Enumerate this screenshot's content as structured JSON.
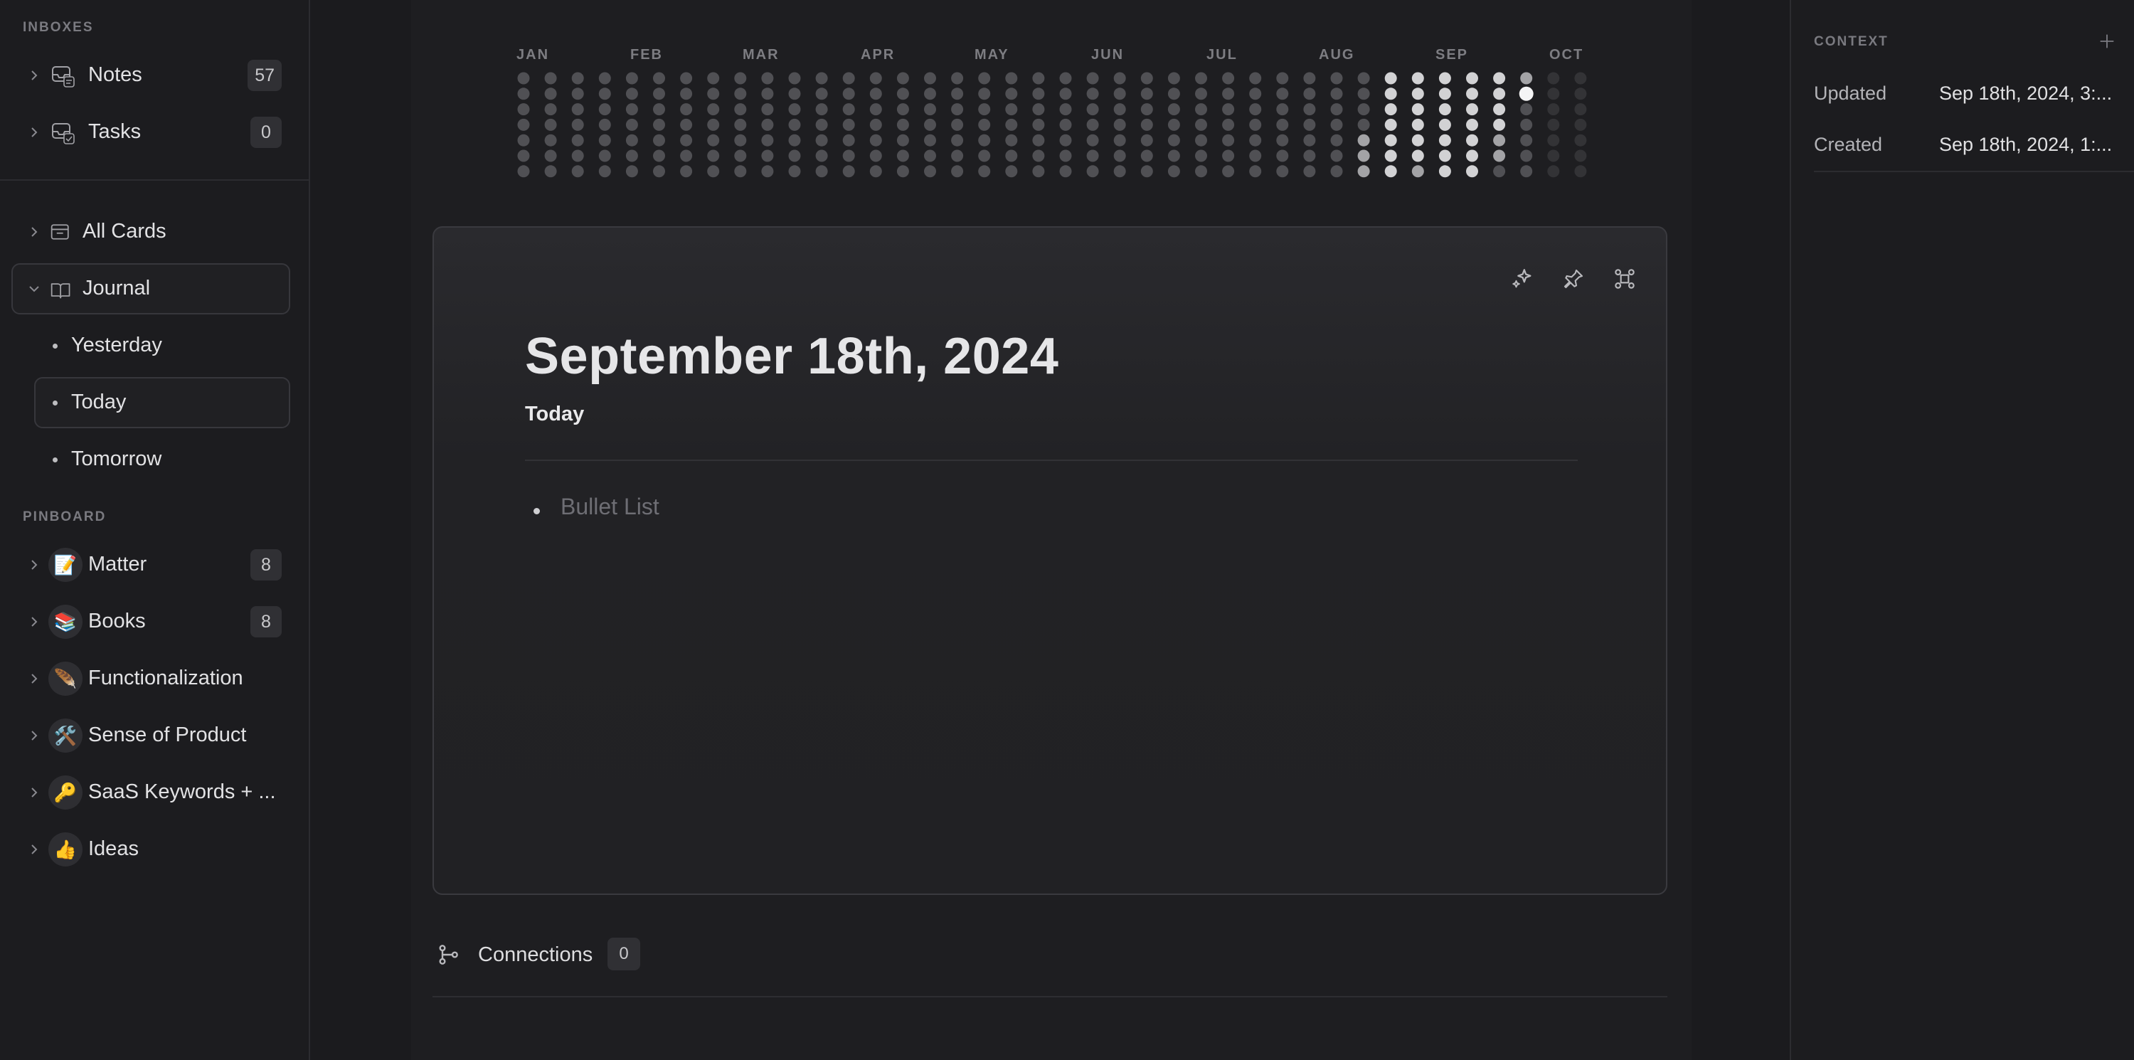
{
  "sidebar": {
    "inboxes_label": "INBOXES",
    "inboxes": [
      {
        "label": "Notes",
        "count": "57"
      },
      {
        "label": "Tasks",
        "count": "0"
      }
    ],
    "all_cards": {
      "label": "All Cards"
    },
    "journal": {
      "label": "Journal",
      "children": [
        {
          "label": "Yesterday"
        },
        {
          "label": "Today"
        },
        {
          "label": "Tomorrow"
        }
      ]
    },
    "pinboard_label": "PINBOARD",
    "pinboard": [
      {
        "label": "Matter",
        "emoji": "📝",
        "count": "8"
      },
      {
        "label": "Books",
        "emoji": "📚",
        "count": "8"
      },
      {
        "label": "Functionalization",
        "emoji": "🪶",
        "count": ""
      },
      {
        "label": "Sense of Product",
        "emoji": "🛠️",
        "count": ""
      },
      {
        "label": "SaaS Keywords + ...",
        "emoji": "🔑",
        "count": ""
      },
      {
        "label": "Ideas",
        "emoji": "👍",
        "count": ""
      }
    ]
  },
  "heatmap": {
    "months": [
      "JAN",
      "FEB",
      "MAR",
      "APR",
      "MAY",
      "JUN",
      "JUL",
      "AUG",
      "SEP",
      "OCT"
    ],
    "weeks": 40,
    "days": 7,
    "levels": {
      "31": [
        0,
        0,
        0,
        0,
        2,
        2,
        2
      ],
      "32": [
        3,
        3,
        3,
        3,
        3,
        3,
        3
      ],
      "33": [
        3,
        3,
        3,
        3,
        3,
        3,
        2
      ],
      "34": [
        3,
        3,
        3,
        3,
        3,
        3,
        3
      ],
      "35": [
        3,
        3,
        3,
        3,
        3,
        3,
        3
      ],
      "36": [
        3,
        3,
        3,
        3,
        2,
        2,
        0
      ],
      "37": [
        2,
        4,
        0,
        0,
        0,
        0,
        0
      ],
      "38": [
        -1,
        -1,
        -1,
        -1,
        -1,
        -1,
        -1
      ],
      "39": [
        -1,
        -1,
        -1,
        -1,
        -1,
        -1,
        -1
      ]
    },
    "colors": {
      "empty": "#505054",
      "future": "#333336",
      "level2": "#a3a3a6",
      "level3": "#d2d2d4",
      "level4": "#f4f4f5"
    }
  },
  "card": {
    "title": "September 18th, 2024",
    "subtitle": "Today",
    "bullet_placeholder": "Bullet List"
  },
  "connections": {
    "label": "Connections",
    "count": "0"
  },
  "context": {
    "title": "CONTEXT",
    "rows": [
      {
        "key": "Updated",
        "value": "Sep 18th, 2024, 3:..."
      },
      {
        "key": "Created",
        "value": "Sep 18th, 2024, 1:..."
      }
    ]
  }
}
